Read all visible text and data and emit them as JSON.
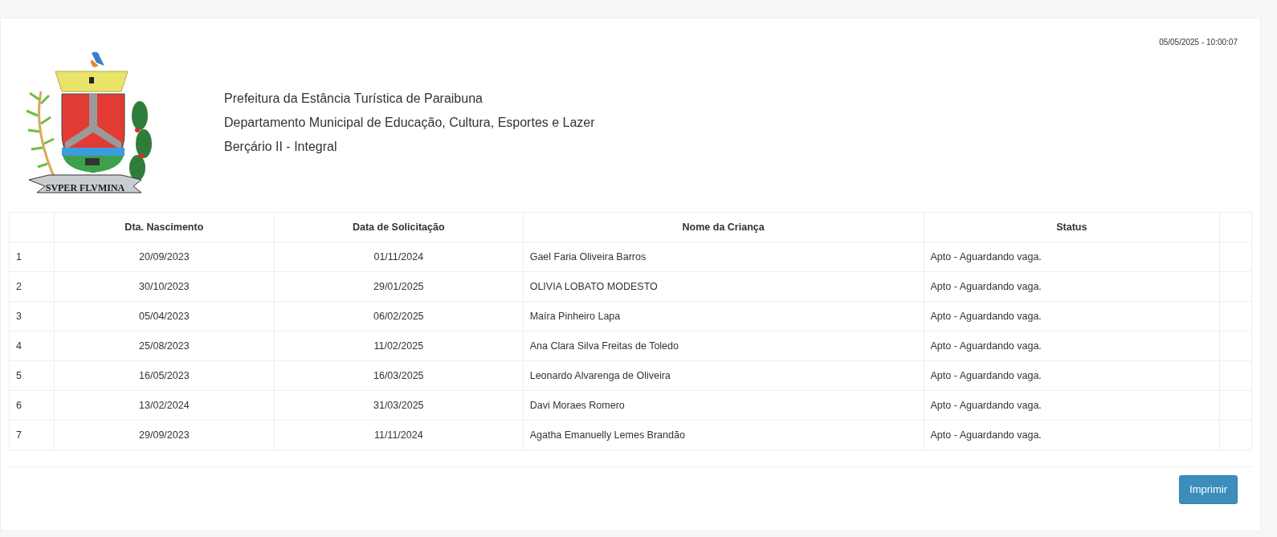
{
  "timestamp": "05/05/2025 - 10:00:07",
  "logo": {
    "motto": "SVPER FLVMINA"
  },
  "header_lines": [
    "Prefeitura da Estância Turística de Paraibuna",
    "Departamento Municipal de Educação, Cultura, Esportes e Lazer",
    "Berçário II - Integral"
  ],
  "table": {
    "columns": [
      "Dta. Nascimento",
      "Data de Solicitação",
      "Nome da Criança",
      "Status"
    ],
    "rows": [
      {
        "number": "1",
        "birth_date": "20/09/2023",
        "request_date": "01/11/2024",
        "child_name": "Gael Faria Oliveira Barros",
        "status": "Apto - Aguardando vaga."
      },
      {
        "number": "2",
        "birth_date": "30/10/2023",
        "request_date": "29/01/2025",
        "child_name": "OLIVIA LOBATO MODESTO",
        "status": "Apto - Aguardando vaga."
      },
      {
        "number": "3",
        "birth_date": "05/04/2023",
        "request_date": "06/02/2025",
        "child_name": "Maíra Pinheiro Lapa",
        "status": "Apto - Aguardando vaga."
      },
      {
        "number": "4",
        "birth_date": "25/08/2023",
        "request_date": "11/02/2025",
        "child_name": "Ana Clara Silva Freitas de Toledo",
        "status": "Apto - Aguardando vaga."
      },
      {
        "number": "5",
        "birth_date": "16/05/2023",
        "request_date": "16/03/2025",
        "child_name": "Leonardo Alvarenga de Oliveira",
        "status": "Apto - Aguardando vaga."
      },
      {
        "number": "6",
        "birth_date": "13/02/2024",
        "request_date": "31/03/2025",
        "child_name": "Davi Moraes Romero",
        "status": "Apto - Aguardando vaga."
      },
      {
        "number": "7",
        "birth_date": "29/09/2023",
        "request_date": "11/11/2024",
        "child_name": "Agatha Emanuelly Lemes Brandão",
        "status": "Apto - Aguardando vaga."
      }
    ]
  },
  "print_button": "Imprimir"
}
